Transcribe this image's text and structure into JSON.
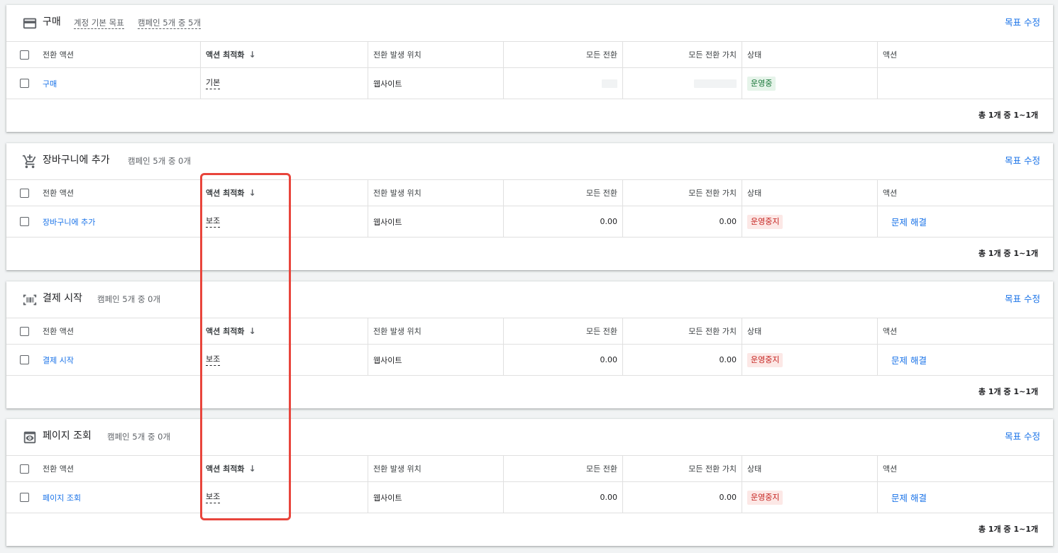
{
  "colors": {
    "accent": "#1a73e8",
    "highlight": "#e8453c",
    "active": "#137333",
    "paused": "#c5221f"
  },
  "table_headers": {
    "action": "전환 액션",
    "optimization": "액션 최적화",
    "source": "전환 발생 위치",
    "all_conversions": "모든 전환",
    "all_value": "모든 전환 가치",
    "status": "상태",
    "actions": "액션"
  },
  "sort_icon": "arrow-down-icon",
  "edit_label": "목표 수정",
  "cards": [
    {
      "icon": "credit-card-icon",
      "title": "구매",
      "meta1": "계정 기본 목표",
      "meta2": "캠페인 5개 중 5개",
      "row": {
        "action": "구매",
        "optimization": "기본",
        "source": "웹사이트",
        "all_conversions": "",
        "all_value": "",
        "status": "운영중",
        "fix": ""
      },
      "pager": "총 1개 중 1~1개"
    },
    {
      "icon": "shopping-cart-icon",
      "title": "장바구니에 추가",
      "meta2": "캠페인 5개 중 0개",
      "row": {
        "action": "장바구니에 추가",
        "optimization": "보조",
        "source": "웹사이트",
        "all_conversions": "0.00",
        "all_value": "0.00",
        "status": "운영중지",
        "fix": "문제 해결"
      },
      "pager": "총 1개 중 1~1개"
    },
    {
      "icon": "barcode-scanner-icon",
      "title": "결제 시작",
      "meta2": "캠페인 5개 중 0개",
      "row": {
        "action": "결제 시작",
        "optimization": "보조",
        "source": "웹사이트",
        "all_conversions": "0.00",
        "all_value": "0.00",
        "status": "운영중지",
        "fix": "문제 해결"
      },
      "pager": "총 1개 중 1~1개"
    },
    {
      "icon": "page-view-eye-icon",
      "title": "페이지 조회",
      "meta2": "캠페인 5개 중 0개",
      "row": {
        "action": "페이지 조회",
        "optimization": "보조",
        "source": "웹사이트",
        "all_conversions": "0.00",
        "all_value": "0.00",
        "status": "운영중지",
        "fix": "문제 해결"
      },
      "pager": "총 1개 중 1~1개"
    }
  ]
}
